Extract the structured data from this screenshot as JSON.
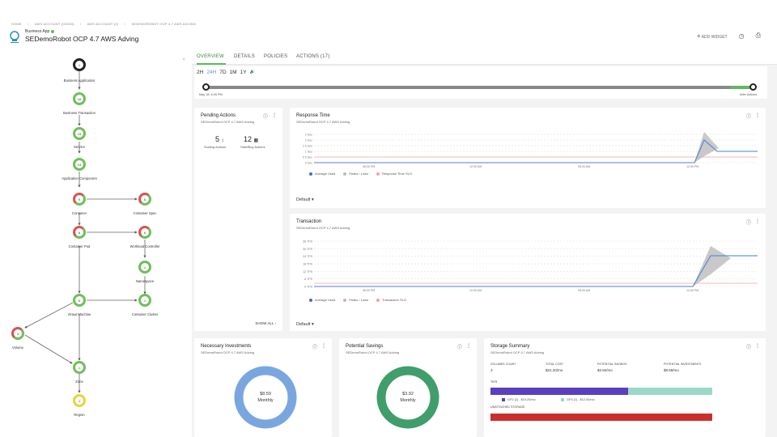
{
  "breadcrumb": [
    "HOME",
    "AWS ACCOUNT (DEMO)",
    "AWS ACCOUNT (2)",
    "SEDEMOROBOT OCP 4.7 AWS ADVING"
  ],
  "header": {
    "business_label": "Business App",
    "title": "SEDemoRobot OCP 4.7 AWS Adving",
    "add_widget": "ADD WIDGET"
  },
  "supply_chain": [
    {
      "id": "business-application",
      "label": "Business Application",
      "count": "1",
      "color": "black"
    },
    {
      "id": "business-transaction",
      "label": "Business Transaction",
      "count": "16",
      "color": "green"
    },
    {
      "id": "service",
      "label": "Service",
      "count": "15",
      "color": "green"
    },
    {
      "id": "application-component",
      "label": "Application Component",
      "count": "14",
      "color": "green"
    },
    {
      "id": "container",
      "label": "Container",
      "count": "9",
      "color": "red"
    },
    {
      "id": "container-spec",
      "label": "Container Spec",
      "count": "6",
      "color": "red"
    },
    {
      "id": "container-pod",
      "label": "Container Pod",
      "count": "6",
      "color": "red"
    },
    {
      "id": "workload-controller",
      "label": "Workload Controller",
      "count": "6",
      "color": "red"
    },
    {
      "id": "namespace",
      "label": "Namespace",
      "count": "1",
      "color": "green"
    },
    {
      "id": "virtual-machine",
      "label": "Virtual Machine",
      "count": "5",
      "color": "green"
    },
    {
      "id": "container-cluster",
      "label": "Container Cluster",
      "count": "1",
      "color": "green"
    },
    {
      "id": "volume",
      "label": "Volume",
      "count": "3",
      "color": "red"
    },
    {
      "id": "zone",
      "label": "Zone",
      "count": "1",
      "color": "green"
    },
    {
      "id": "region",
      "label": "Region",
      "count": "1",
      "color": "yellow"
    }
  ],
  "tabs": [
    "OVERVIEW",
    "DETAILS",
    "POLICIES",
    "ACTIONS (17)"
  ],
  "timeline": {
    "ranges": [
      "2H",
      "24H",
      "7D",
      "1M",
      "1Y"
    ],
    "selected": "24H",
    "start_label": "May 18, 6:00 PM",
    "end_label": "After Actions"
  },
  "pending_actions": {
    "title": "Pending Actions",
    "subtitle": "SEDemoRobot OCP 4.7 AWS Adving",
    "scaling_count": "5",
    "scaling_label": "Scaling Actions",
    "startbuy_count": "12",
    "startbuy_label": "Start/Buy Actions",
    "show_all": "SHOW ALL"
  },
  "response_time": {
    "title": "Response Time",
    "subtitle": "SEDemoRobot OCP 4.7 AWS Adving",
    "yticks": [
      "2 Sec",
      "2 Sec",
      "1.5 Sec",
      "1 Sec",
      "0.5 Sec",
      "0 Sec"
    ],
    "xticks": [
      "06:30 PM",
      "12:00 AM",
      "06:00 AM",
      "12:00 PM"
    ],
    "legend": [
      "Average Used",
      "Peaks / Lows",
      "Response Time SLO"
    ],
    "dropdown": "Default"
  },
  "transaction": {
    "title": "Transaction",
    "subtitle": "SEDemoRobot OCP 4.7 AWS Adving",
    "yticks": [
      "36 TPS",
      "30 TPS",
      "24 TPS",
      "18 TPS",
      "12 TPS",
      "6 TPS",
      "0 TPS"
    ],
    "xticks": [
      "06:30 PM",
      "12:00 AM",
      "06:00 AM",
      "12:00 PM"
    ],
    "legend": [
      "Average Used",
      "Peaks / Lows",
      "Transaction SLO"
    ],
    "dropdown": "Default"
  },
  "necessary_investments": {
    "title": "Necessary Investments",
    "subtitle": "SEDemoRobot OCP 4.7 AWS Adving",
    "value": "$8.59",
    "period": "Monthly",
    "color": "#7aa6e0"
  },
  "potential_savings": {
    "title": "Potential Savings",
    "subtitle": "SEDemoRobot OCP 4.7 AWS Adving",
    "value": "$3.92",
    "period": "Monthly",
    "color": "#3f9e6a"
  },
  "storage_summary": {
    "title": "Storage Summary",
    "subtitle": "SEDemoRobot OCP 4.7 AWS Adving",
    "headers": [
      "VOLUMES COUNT",
      "TOTAL COST",
      "POTENTIAL SAVINGS",
      "POTENTIAL INVESTMENTS"
    ],
    "values": [
      "3",
      "$31.20/mo",
      "$3.92/mo",
      "$8.59/mo"
    ],
    "tier_label": "TIER",
    "tier_legend": [
      "GP2 (2) - $19.20/mo",
      "GP3 (1) - $12.00/mo"
    ],
    "tier_colors": [
      "#5a3fc0",
      "#9ad9c7"
    ],
    "tier_fraction": 0.62,
    "unattached_label": "UNATTACHED STORAGE",
    "unattached_color": "#c9302c"
  }
}
